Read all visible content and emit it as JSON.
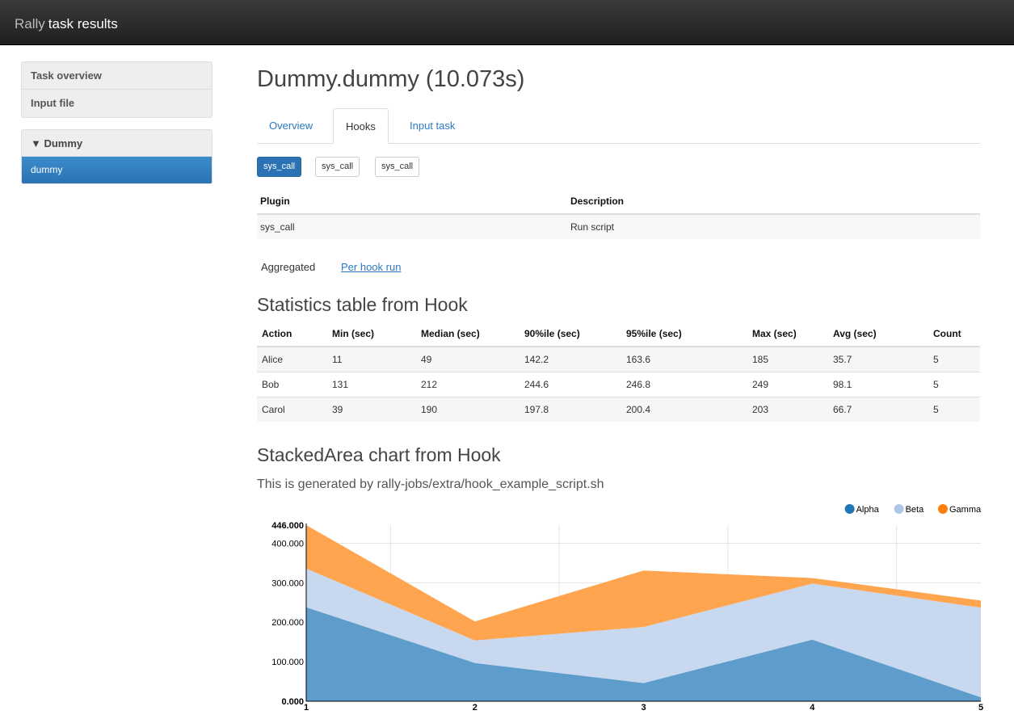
{
  "navbar": {
    "brand": "Rally",
    "title": "task results"
  },
  "sidebar": {
    "top_items": [
      "Task overview",
      "Input file"
    ],
    "group_label": "▼ Dummy",
    "group_items": [
      "dummy"
    ]
  },
  "page": {
    "title": "Dummy.dummy (10.073s)"
  },
  "tabs": [
    "Overview",
    "Hooks",
    "Input task"
  ],
  "active_tab": "Hooks",
  "hook_buttons": [
    "sys_call",
    "sys_call",
    "sys_call"
  ],
  "plugin_table": {
    "headers": [
      "Plugin",
      "Description"
    ],
    "rows": [
      [
        "sys_call",
        "Run script"
      ]
    ]
  },
  "view_switch": {
    "aggregated": "Aggregated",
    "per_hook": "Per hook run"
  },
  "stats": {
    "title": "Statistics table from Hook",
    "headers": [
      "Action",
      "Min (sec)",
      "Median (sec)",
      "90%ile (sec)",
      "95%ile (sec)",
      "Max (sec)",
      "Avg (sec)",
      "Count"
    ],
    "rows": [
      [
        "Alice",
        "11",
        "49",
        "142.2",
        "163.6",
        "185",
        "35.7",
        "5"
      ],
      [
        "Bob",
        "131",
        "212",
        "244.6",
        "246.8",
        "249",
        "98.1",
        "5"
      ],
      [
        "Carol",
        "39",
        "190",
        "197.8",
        "200.4",
        "203",
        "66.7",
        "5"
      ]
    ]
  },
  "chart_section": {
    "title": "StackedArea chart from Hook",
    "subtitle": "This is generated by rally-jobs/extra/hook_example_script.sh"
  },
  "chart_data": {
    "type": "area",
    "stacked": true,
    "x": [
      1,
      2,
      3,
      4,
      5
    ],
    "series": [
      {
        "name": "Alpha",
        "color": "#5e9dcb",
        "legend_color": "#1f77b4",
        "values": [
          238,
          97,
          46,
          156,
          10
        ]
      },
      {
        "name": "Beta",
        "color": "#c7d8ef",
        "legend_color": "#aec7e8",
        "values": [
          98,
          57,
          142,
          142,
          227
        ]
      },
      {
        "name": "Gamma",
        "color": "#ffa54f",
        "legend_color": "#ff7f0e",
        "values": [
          110,
          48,
          143,
          14,
          18
        ]
      }
    ],
    "yticks": [
      "0.000",
      "100.000",
      "200.000",
      "300.000",
      "400.000",
      "446.000"
    ],
    "ylim": [
      0,
      446
    ],
    "grid": true,
    "legend_position": "top-right"
  }
}
